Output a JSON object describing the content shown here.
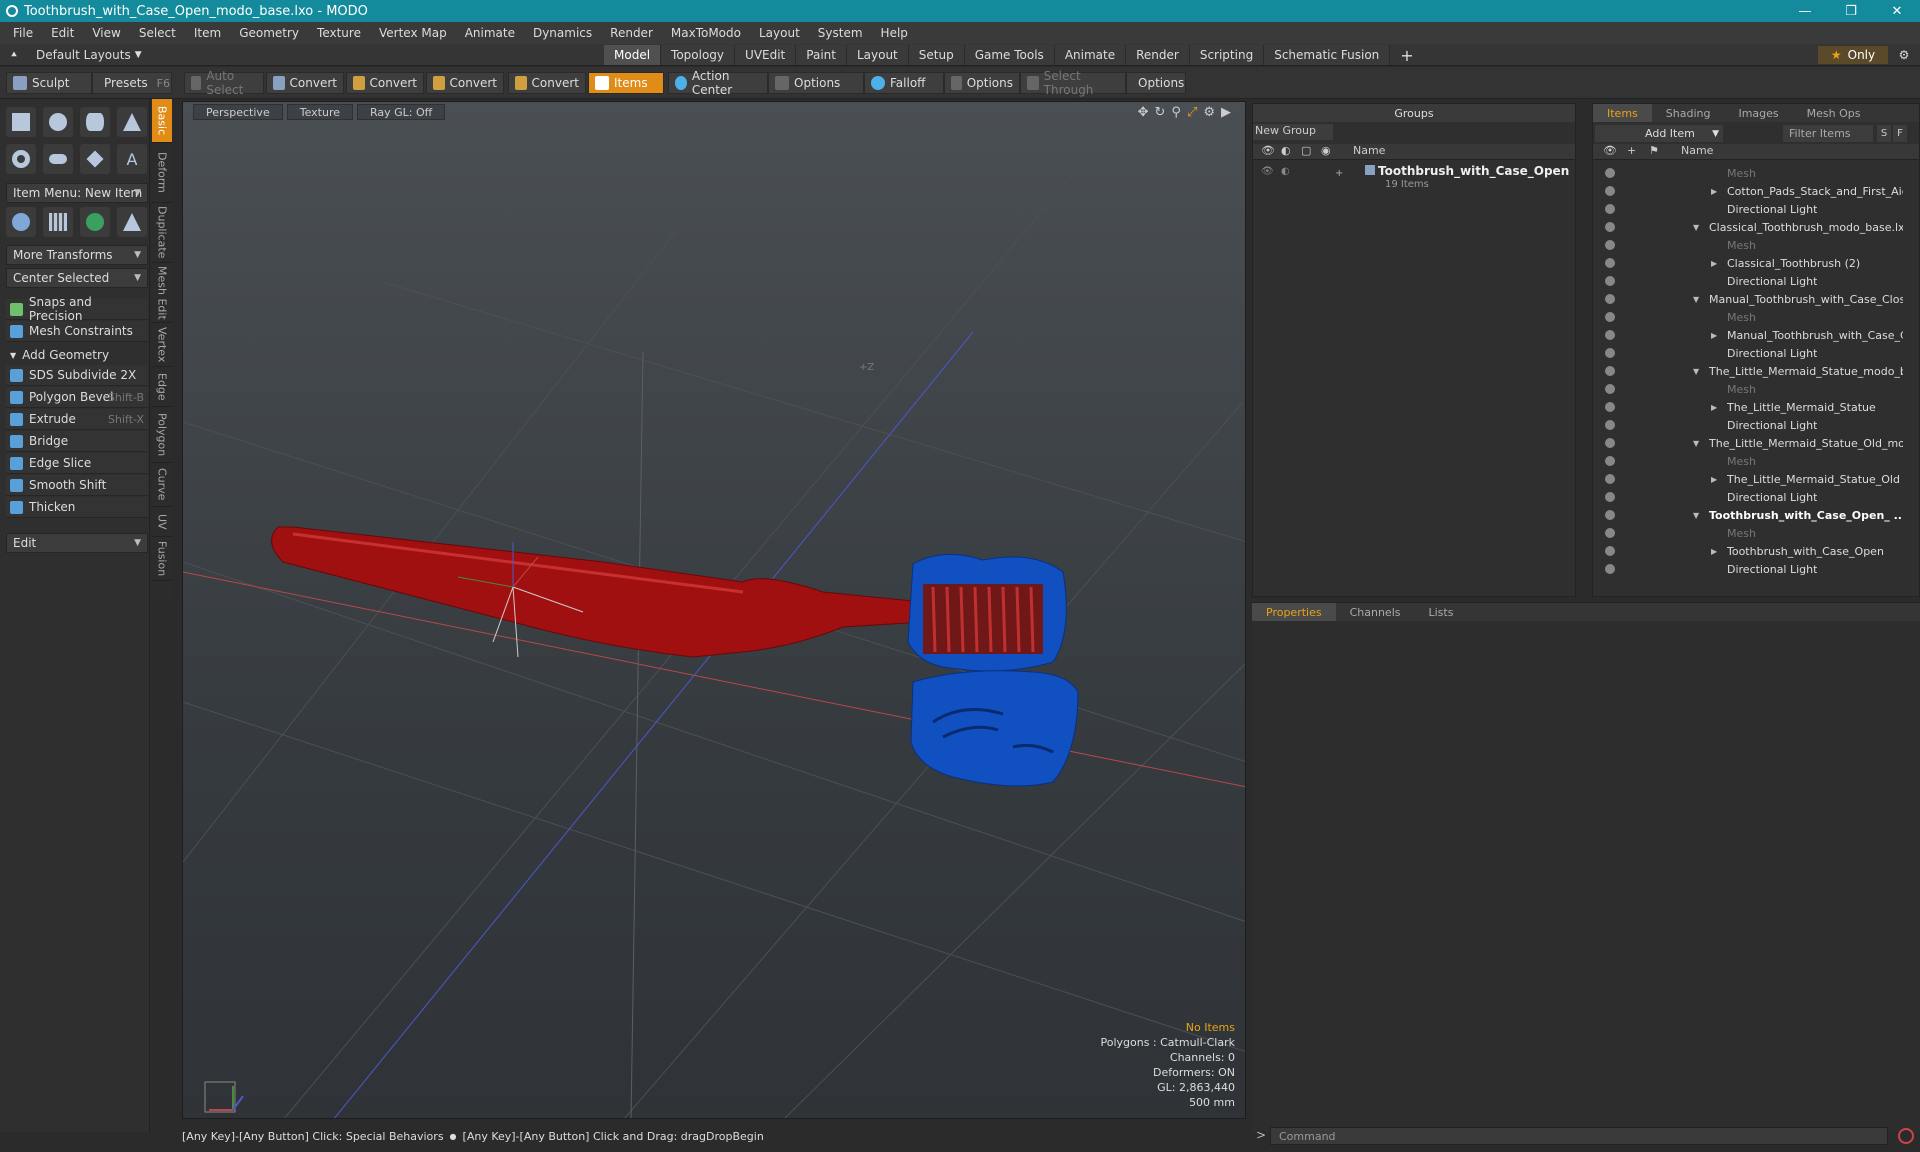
{
  "window": {
    "title": "Toothbrush_with_Case_Open_modo_base.lxo - MODO",
    "controls": [
      "—",
      "❐",
      "✕"
    ]
  },
  "menu": [
    "File",
    "Edit",
    "View",
    "Select",
    "Item",
    "Geometry",
    "Texture",
    "Vertex Map",
    "Animate",
    "Dynamics",
    "Render",
    "MaxToModo",
    "Layout",
    "System",
    "Help"
  ],
  "layout": {
    "default_layouts": "Default Layouts",
    "tabs": [
      "Model",
      "Topology",
      "UVEdit",
      "Paint",
      "Layout",
      "Setup",
      "Game Tools",
      "Animate",
      "Render",
      "Scripting",
      "Schematic Fusion"
    ],
    "active_tab": "Model",
    "only_label": "Only"
  },
  "toolbar": {
    "sculpt": "Sculpt",
    "presets": "Presets",
    "presets_key": "F6",
    "auto_select": "Auto Select",
    "convert": "Convert",
    "items": "Items",
    "action_center": "Action Center",
    "options": "Options",
    "falloff": "Falloff",
    "select_through": "Select Through"
  },
  "left_panel": {
    "item_menu": "Item Menu: New Item",
    "more_transforms": "More Transforms",
    "center_selected": "Center Selected",
    "snaps": "Snaps and Precision",
    "mesh_constraints": "Mesh Constraints",
    "add_geometry": "Add Geometry",
    "tools": [
      {
        "label": "SDS Subdivide 2X",
        "shortcut": ""
      },
      {
        "label": "Polygon Bevel",
        "shortcut": "Shift-B"
      },
      {
        "label": "Extrude",
        "shortcut": "Shift-X"
      },
      {
        "label": "Bridge",
        "shortcut": ""
      },
      {
        "label": "Edge Slice",
        "shortcut": ""
      },
      {
        "label": "Smooth Shift",
        "shortcut": ""
      },
      {
        "label": "Thicken",
        "shortcut": ""
      }
    ],
    "edit": "Edit",
    "side_tabs": [
      "Basic",
      "Deform",
      "Duplicate",
      "Mesh Edit",
      "Vertex",
      "Edge",
      "Polygon",
      "Curve",
      "UV",
      "Fusion"
    ]
  },
  "viewport": {
    "view": "Perspective",
    "shading": "Texture",
    "raygl": "Ray GL: Off",
    "info": {
      "selection": "No Items",
      "polygons": "Polygons : Catmull-Clark",
      "channels": "Channels: 0",
      "deformers": "Deformers: ON",
      "gl": "GL: 2,863,440",
      "scale": "500 mm"
    },
    "axis_label": "+Z",
    "colors": {
      "handle": "#a01010",
      "case": "#1050c0",
      "grid_x": "#c04040",
      "grid_z": "#4050c0"
    }
  },
  "statusbar": {
    "text1": "[Any Key]-[Any Button] Click: Special Behaviors",
    "text2": "[Any Key]-[Any Button] Click and Drag: dragDropBegin"
  },
  "groups": {
    "title": "Groups",
    "new_group": "New Group",
    "name_col": "Name",
    "group_name": "Toothbrush_with_Case_Open",
    "group_count": "19 Items"
  },
  "items": {
    "tabs": [
      "Items",
      "Shading",
      "Images",
      "Mesh Ops"
    ],
    "active_tab": "Items",
    "add_item": "Add Item",
    "filter": "Filter Items",
    "s_btn": "S",
    "f_btn": "F",
    "name_col": "Name",
    "rows": [
      {
        "label": "Mesh",
        "indent": 2,
        "dim": true,
        "bold": false,
        "tri": ""
      },
      {
        "label": "Cotton_Pads_Stack_and_First_Aid...",
        "indent": 2,
        "dim": false,
        "bold": false,
        "tri": "▶"
      },
      {
        "label": "Directional Light",
        "indent": 2,
        "dim": false,
        "bold": false,
        "tri": ""
      },
      {
        "label": "Classical_Toothbrush_modo_base.lxo*",
        "indent": 1,
        "dim": false,
        "bold": false,
        "tri": "▼"
      },
      {
        "label": "Mesh",
        "indent": 2,
        "dim": true,
        "bold": false,
        "tri": ""
      },
      {
        "label": "Classical_Toothbrush (2)",
        "indent": 2,
        "dim": false,
        "bold": false,
        "tri": "▶"
      },
      {
        "label": "Directional Light",
        "indent": 2,
        "dim": false,
        "bold": false,
        "tri": ""
      },
      {
        "label": "Manual_Toothbrush_with_Case_Clos ...",
        "indent": 1,
        "dim": false,
        "bold": false,
        "tri": "▼"
      },
      {
        "label": "Mesh",
        "indent": 2,
        "dim": true,
        "bold": false,
        "tri": ""
      },
      {
        "label": "Manual_Toothbrush_with_Case_Cl...",
        "indent": 2,
        "dim": false,
        "bold": false,
        "tri": "▶"
      },
      {
        "label": "Directional Light",
        "indent": 2,
        "dim": false,
        "bold": false,
        "tri": ""
      },
      {
        "label": "The_Little_Mermaid_Statue_modo_b ...",
        "indent": 1,
        "dim": false,
        "bold": false,
        "tri": "▼"
      },
      {
        "label": "Mesh",
        "indent": 2,
        "dim": true,
        "bold": false,
        "tri": ""
      },
      {
        "label": "The_Little_Mermaid_Statue",
        "indent": 2,
        "dim": false,
        "bold": false,
        "tri": "▶"
      },
      {
        "label": "Directional Light",
        "indent": 2,
        "dim": false,
        "bold": false,
        "tri": ""
      },
      {
        "label": "The_Little_Mermaid_Statue_Old_mod...",
        "indent": 1,
        "dim": false,
        "bold": false,
        "tri": "▼"
      },
      {
        "label": "Mesh",
        "indent": 2,
        "dim": true,
        "bold": false,
        "tri": ""
      },
      {
        "label": "The_Little_Mermaid_Statue_Old",
        "indent": 2,
        "dim": false,
        "bold": false,
        "tri": "▶"
      },
      {
        "label": "Directional Light",
        "indent": 2,
        "dim": false,
        "bold": false,
        "tri": ""
      },
      {
        "label": "Toothbrush_with_Case_Open_ ...",
        "indent": 1,
        "dim": false,
        "bold": true,
        "tri": "▼"
      },
      {
        "label": "Mesh",
        "indent": 2,
        "dim": true,
        "bold": false,
        "tri": ""
      },
      {
        "label": "Toothbrush_with_Case_Open",
        "indent": 2,
        "dim": false,
        "bold": false,
        "tri": "▶"
      },
      {
        "label": "Directional Light",
        "indent": 2,
        "dim": false,
        "bold": false,
        "tri": ""
      }
    ]
  },
  "properties": {
    "tabs": [
      "Properties",
      "Channels",
      "Lists"
    ],
    "active_tab": "Properties"
  },
  "command": {
    "placeholder": "Command"
  }
}
